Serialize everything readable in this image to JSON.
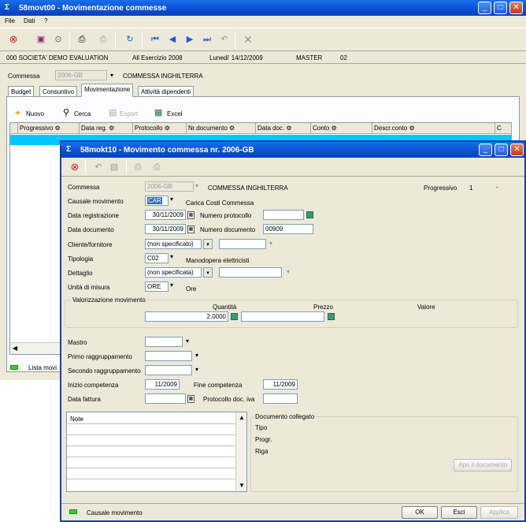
{
  "back_window": {
    "title": "58movt00 - Movimentazione commesse",
    "menu": [
      "File",
      "Dati",
      "?"
    ],
    "info_bar": [
      "000 SOCIETA' DEMO EVALUATION",
      "All Esercizio 2008",
      "Lunedi' 14/12/2009",
      "MASTER",
      "02"
    ],
    "commessa_label": "Commessa",
    "commessa_value": "2006-GB",
    "commessa_desc": "COMMESSA INGHILTERRA",
    "tabs": [
      "Budget",
      "Consuntivo",
      "Movimentazione",
      "Attività dipendenti"
    ],
    "actions": {
      "nuovo": "Nuovo",
      "cerca": "Cerca",
      "export": "Export",
      "excel": "Excel"
    },
    "columns": [
      "Progressivo",
      "Data reg.",
      "Protocollo",
      "Nr.documento",
      "Data doc.",
      "Conto",
      "Descr.conto",
      "C"
    ],
    "status": "Lista movi"
  },
  "front_window": {
    "title": "58mokt10 - Movimento commessa nr. 2006-GB",
    "fields": {
      "commessa_label": "Commessa",
      "commessa_value": "2006-GB",
      "commessa_desc": "COMMESSA INGHILTERRA",
      "progressivo_label": "Progressivo",
      "progressivo_value": "1",
      "progressivo_dash": "-",
      "causale_label": "Causale movimento",
      "causale_value": "CAR",
      "causale_desc": "Carica Costi Commessa",
      "data_reg_label": "Data registrazione",
      "data_reg_value": "30/11/2009",
      "num_prot_label": "Numero protocollo",
      "num_prot_value": "",
      "data_doc_label": "Data documento",
      "data_doc_value": "30/11/2009",
      "num_doc_label": "Numero documento",
      "num_doc_value": "00909",
      "cliente_label": "Cliente/fornitore",
      "cliente_value": "(non specificato)",
      "tipologia_label": "Tipologia",
      "tipologia_value": "C02",
      "tipologia_desc": "Manodopera elettricisti",
      "dettaglio_label": "Dettaglio",
      "dettaglio_value": "(non specificata)",
      "unita_label": "Unità di misura",
      "unita_value": "ORE",
      "unita_desc": "Ore",
      "valorizzazione_label": "Valorizzazione movimento",
      "quantita_label": "Quantità",
      "quantita_value": "2,0000",
      "prezzo_label": "Prezzo",
      "prezzo_value": "",
      "valore_label": "Valore",
      "mastro_label": "Mastro",
      "primo_label": "Primo raggruppamento",
      "secondo_label": "Secondo raggruppamento",
      "inizio_label": "Inizio competenza",
      "inizio_value": "11/2009",
      "fine_label": "Fine competenza",
      "fine_value": "11/2009",
      "data_fatt_label": "Data fattura",
      "prot_iva_label": "Protocollo doc. iva",
      "note_label": "Note",
      "doc_collegato_label": "Documento collegato",
      "tipo_label": "Tipo",
      "progr_label": "Progr.",
      "riga_label": "Riga",
      "apri_doc": "Apri il documento"
    },
    "status": "Causale movimento",
    "buttons": {
      "ok": "OK",
      "esci": "Esci",
      "applica": "Applica"
    }
  },
  "colors": {
    "titlebar": "#0a4fd3",
    "window_bg": "#ece9d8",
    "selection": "#00c8ff"
  }
}
